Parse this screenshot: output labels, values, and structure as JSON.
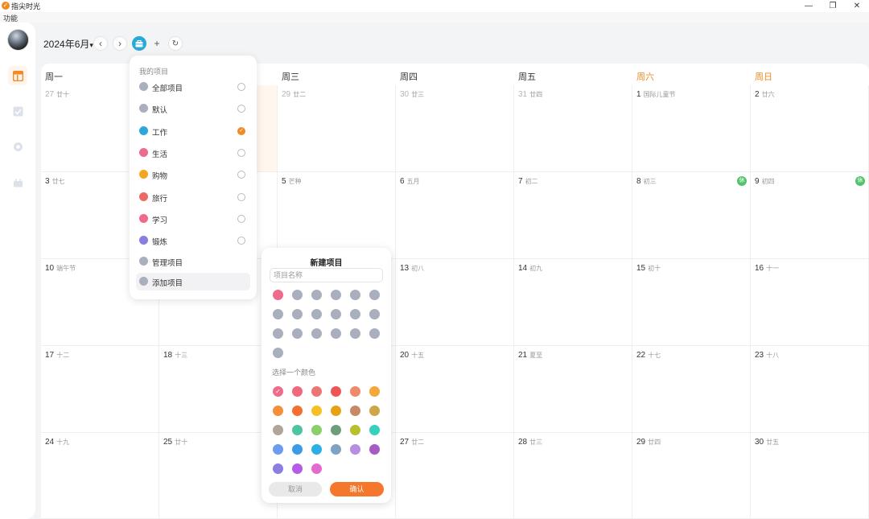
{
  "window": {
    "title": "指尖时光",
    "logo_glyph": "✓",
    "minimize": "—",
    "restore": "❐",
    "close": "✕"
  },
  "menu": {
    "func": "功能"
  },
  "toolbar": {
    "month_label": "2024年6月",
    "dropdown": "▾",
    "prev": "‹",
    "next": "›",
    "add": "+",
    "refresh": "↻"
  },
  "weekdays": [
    "周一",
    "周二",
    "周三",
    "周四",
    "周五",
    "周六",
    "周日"
  ],
  "weeks": [
    [
      {
        "d": "27",
        "l": "廿十",
        "other": true
      },
      {
        "d": "",
        "l": "",
        "other": true,
        "today": true
      },
      {
        "d": "29",
        "l": "廿二",
        "other": true
      },
      {
        "d": "30",
        "l": "廿三",
        "other": true
      },
      {
        "d": "31",
        "l": "廿四",
        "other": true
      },
      {
        "d": "1",
        "l": "国际儿童节"
      },
      {
        "d": "2",
        "l": "廿六"
      }
    ],
    [
      {
        "d": "3",
        "l": "廿七"
      },
      {
        "d": "",
        "l": ""
      },
      {
        "d": "5",
        "l": "芒种"
      },
      {
        "d": "6",
        "l": "五月"
      },
      {
        "d": "7",
        "l": "初二"
      },
      {
        "d": "8",
        "l": "初三",
        "rest": "休"
      },
      {
        "d": "9",
        "l": "初四",
        "rest": "休"
      }
    ],
    [
      {
        "d": "10",
        "l": "端午节"
      },
      {
        "d": "",
        "l": ""
      },
      {
        "d": "",
        "l": ""
      },
      {
        "d": "13",
        "l": "初八"
      },
      {
        "d": "14",
        "l": "初九"
      },
      {
        "d": "15",
        "l": "初十"
      },
      {
        "d": "16",
        "l": "十一"
      }
    ],
    [
      {
        "d": "17",
        "l": "十二"
      },
      {
        "d": "18",
        "l": "十三"
      },
      {
        "d": "",
        "l": ""
      },
      {
        "d": "20",
        "l": "十五"
      },
      {
        "d": "21",
        "l": "夏至"
      },
      {
        "d": "22",
        "l": "十七"
      },
      {
        "d": "23",
        "l": "十八"
      }
    ],
    [
      {
        "d": "24",
        "l": "十九"
      },
      {
        "d": "25",
        "l": "廿十"
      },
      {
        "d": "",
        "l": ""
      },
      {
        "d": "27",
        "l": "廿二"
      },
      {
        "d": "28",
        "l": "廿三"
      },
      {
        "d": "29",
        "l": "廿四"
      },
      {
        "d": "30",
        "l": "廿五"
      }
    ]
  ],
  "project_menu": {
    "header": "我的项目",
    "items": [
      {
        "label": "全部项目",
        "color": "#a9afbd",
        "checked": false
      },
      {
        "label": "默认",
        "color": "#a9afbd",
        "checked": false
      },
      {
        "label": "工作",
        "color": "#2aa8d8",
        "checked": true
      },
      {
        "label": "生活",
        "color": "#ee6b8b",
        "checked": false
      },
      {
        "label": "购物",
        "color": "#f5a524",
        "checked": false
      },
      {
        "label": "旅行",
        "color": "#ec6a64",
        "checked": false
      },
      {
        "label": "学习",
        "color": "#ee6b8b",
        "checked": false
      },
      {
        "label": "锻炼",
        "color": "#8a7ee0",
        "checked": false
      }
    ],
    "manage": "管理项目",
    "add": "添加项目",
    "check_glyph": "✓"
  },
  "new_project": {
    "title": "新建项目",
    "name_placeholder": "项目名称",
    "color_label": "选择一个颜色",
    "cancel": "取消",
    "confirm": "确认",
    "selected_glyph": "✓",
    "icons": [
      "tag-icon",
      "briefcase-icon",
      "sofa-icon",
      "basket-icon",
      "plane-icon",
      "mail-icon",
      "gear-icon",
      "document-icon",
      "cart-icon",
      "car-icon",
      "bus-icon",
      "home-icon",
      "card-icon",
      "lock-icon",
      "pen-icon",
      "gift-icon",
      "grid-icon",
      "box-icon",
      "chart-icon"
    ],
    "colors": [
      "#f06a8a",
      "#f0697a",
      "#ec7672",
      "#ee5656",
      "#ef8a6a",
      "#f5a83a",
      "#f59038",
      "#f56f2e",
      "#f5c021",
      "#e5a314",
      "#c68a66",
      "#d0a54a",
      "#b0a599",
      "#4ec4a0",
      "#8bcf6a",
      "#6c9e7b",
      "#b8c02e",
      "#35d1bd",
      "#6d9bed",
      "#3a9ce8",
      "#2ab0e6",
      "#7ea3c4",
      "#b68fe0",
      "#a85bc4",
      "#8a7ee0",
      "#b45ce8",
      "#e56ad0"
    ]
  }
}
